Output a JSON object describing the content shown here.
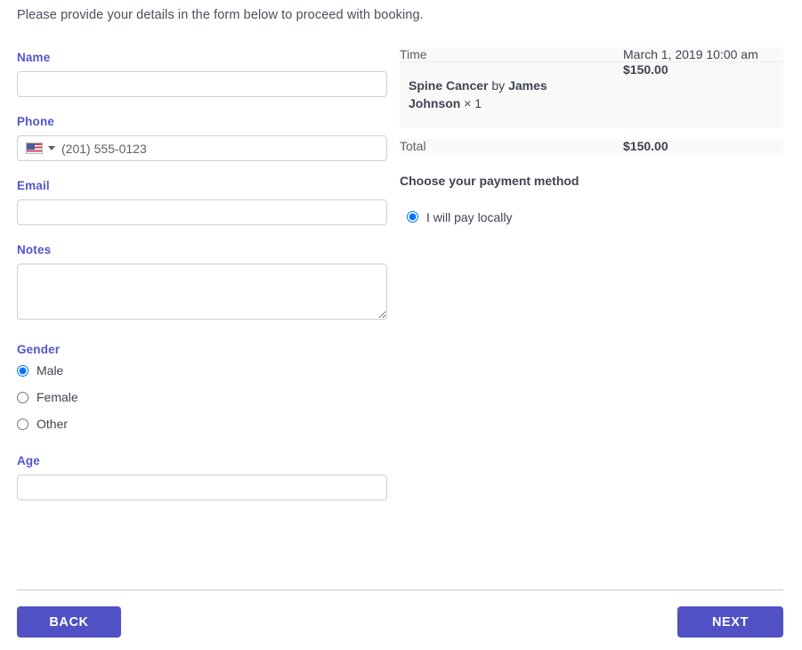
{
  "intro": "Please provide your details in the form below to proceed with booking.",
  "form": {
    "name": {
      "label": "Name",
      "value": "",
      "placeholder": ""
    },
    "phone": {
      "label": "Phone",
      "value": "",
      "placeholder": "(201) 555-0123",
      "country_flag": "us-flag-icon",
      "dropdown_icon": "chevron-down-icon"
    },
    "email": {
      "label": "Email",
      "value": "",
      "placeholder": ""
    },
    "notes": {
      "label": "Notes",
      "value": "",
      "placeholder": ""
    },
    "gender": {
      "label": "Gender",
      "selected": "Male",
      "options": [
        {
          "label": "Male",
          "checked": true
        },
        {
          "label": "Female",
          "checked": false
        },
        {
          "label": "Other",
          "checked": false
        }
      ]
    },
    "age": {
      "label": "Age",
      "value": "",
      "placeholder": ""
    }
  },
  "summary": {
    "time": {
      "label": "Time",
      "value": "March 1, 2019 10:00 am"
    },
    "product": {
      "name": "Spine Cancer",
      "by_text": "by",
      "provider": "James Johnson",
      "quantity_text": "× 1",
      "price": "$150.00"
    },
    "total": {
      "label": "Total",
      "value": "$150.00"
    }
  },
  "payment": {
    "heading": "Choose your payment method",
    "options": [
      {
        "label": "I will pay locally",
        "checked": true
      }
    ]
  },
  "footer": {
    "back_label": "BACK",
    "next_label": "NEXT"
  },
  "colors": {
    "accent": "#4f51c4",
    "label": "#5356cd",
    "row_bg": "#f9f9f9",
    "border": "#cfcfd4",
    "divider": "#c8c8cc"
  }
}
